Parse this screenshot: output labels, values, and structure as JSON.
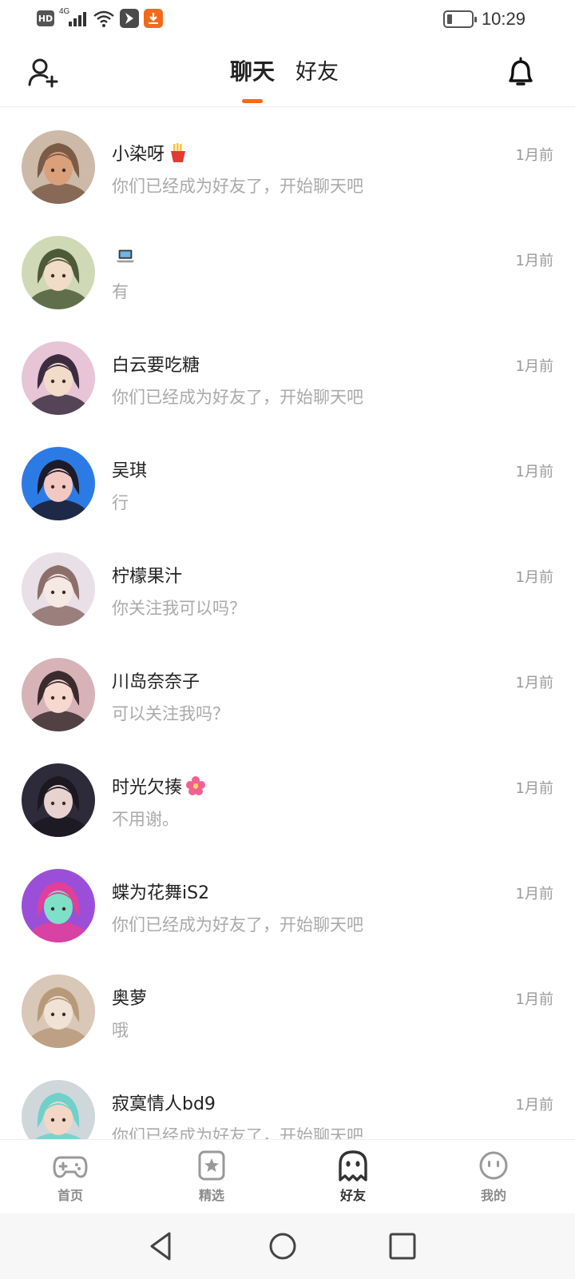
{
  "status_bar": {
    "hd_label": "HD",
    "network_label": "4G",
    "time": "10:29"
  },
  "header": {
    "tabs": [
      {
        "label": "聊天",
        "active": true
      },
      {
        "label": "好友",
        "active": false
      }
    ],
    "accent_color": "#f26a1b"
  },
  "conversations": [
    {
      "name": "小染呀",
      "emoji": "fries",
      "time": "1月前",
      "message": "你们已经成为好友了，开始聊天吧",
      "avatar_colors": [
        "#cdb9a8",
        "#7a5b46",
        "#d9a07a"
      ]
    },
    {
      "name": "",
      "emoji": "laptop",
      "time": "1月前",
      "message": "有",
      "avatar_colors": [
        "#cfd9b5",
        "#4d5a3a",
        "#f0dcc7"
      ]
    },
    {
      "name": "白云要吃糖",
      "emoji": "",
      "time": "1月前",
      "message": "你们已经成为好友了，开始聊天吧",
      "avatar_colors": [
        "#e7c4d6",
        "#3b2d3f",
        "#f3dbc9"
      ]
    },
    {
      "name": "吴琪",
      "emoji": "",
      "time": "1月前",
      "message": "行",
      "avatar_colors": [
        "#2c7be5",
        "#1b1b2b",
        "#f2c8c2"
      ]
    },
    {
      "name": "柠檬果汁",
      "emoji": "",
      "time": "1月前",
      "message": "你关注我可以吗？",
      "avatar_colors": [
        "#e9dfe7",
        "#8c6f6a",
        "#f6e9e3"
      ]
    },
    {
      "name": "川岛奈奈子",
      "emoji": "",
      "time": "1月前",
      "message": "可以关注我吗？",
      "avatar_colors": [
        "#d7b3b8",
        "#3a2b2f",
        "#f7d8cf"
      ]
    },
    {
      "name": "时光欠揍",
      "emoji": "flower",
      "time": "1月前",
      "message": "不用谢。",
      "avatar_colors": [
        "#2d2a3a",
        "#1c1820",
        "#e8d2cf"
      ]
    },
    {
      "name": "蝶为花舞iS2",
      "emoji": "",
      "time": "1月前",
      "message": "你们已经成为好友了，开始聊天吧",
      "avatar_colors": [
        "#9b4fd8",
        "#e23f9a",
        "#7ee0c6"
      ]
    },
    {
      "name": "奥萝",
      "emoji": "",
      "time": "1月前",
      "message": "哦",
      "avatar_colors": [
        "#d9c7b8",
        "#b89a7a",
        "#f1e2d6"
      ]
    },
    {
      "name": "寂寞情人bd9",
      "emoji": "",
      "time": "1月前",
      "message": "你们已经成为好友了，开始聊天吧",
      "avatar_colors": [
        "#cfd7da",
        "#6fd1c9",
        "#f2d7c7"
      ]
    }
  ],
  "bottom_nav": {
    "items": [
      {
        "label": "首页",
        "icon": "gamepad-icon",
        "active": false
      },
      {
        "label": "精选",
        "icon": "star-badge-icon",
        "active": false
      },
      {
        "label": "好友",
        "icon": "ghost-icon",
        "active": true
      },
      {
        "label": "我的",
        "icon": "face-icon",
        "active": false
      }
    ]
  },
  "system_nav": {
    "buttons": [
      "back-icon",
      "home-icon",
      "recents-icon"
    ]
  }
}
